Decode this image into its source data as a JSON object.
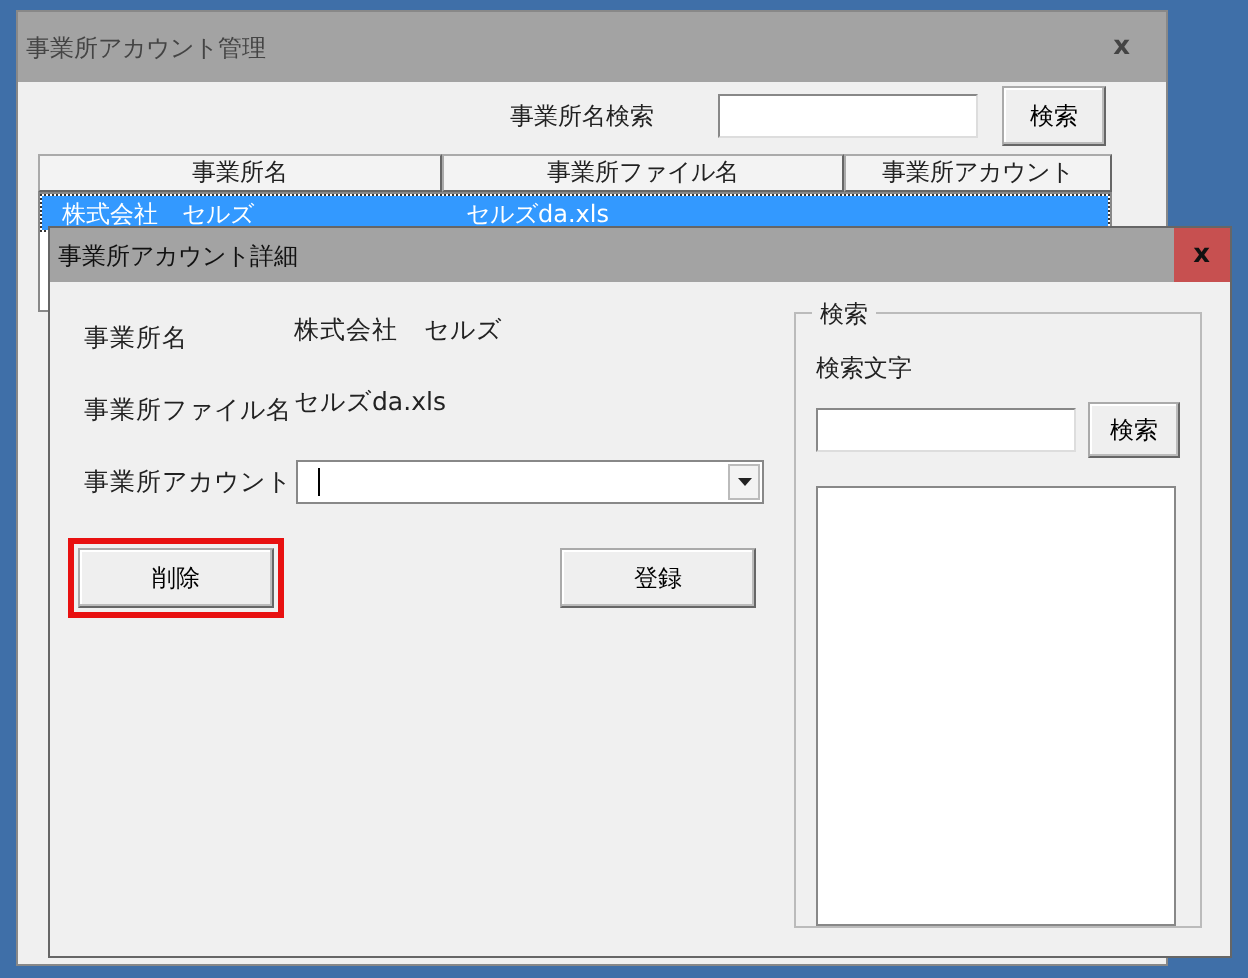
{
  "main_window": {
    "title": "事業所アカウント管理",
    "close": "x",
    "search_label": "事業所名検索",
    "search_button": "検索",
    "list": {
      "columns": [
        "事業所名",
        "事業所ファイル名",
        "事業所アカウント"
      ],
      "rows": [
        {
          "cells": [
            "株式会社　セルズ",
            "セルズda.xls"
          ],
          "selected": true
        }
      ]
    }
  },
  "detail_dialog": {
    "title": "事業所アカウント詳細",
    "close": "x",
    "fields": [
      {
        "kind": "text",
        "label": "事業所名",
        "value": "株式会社　セルズ"
      },
      {
        "kind": "text",
        "label": "事業所ファイル名",
        "value": "セルズda.xls"
      },
      {
        "kind": "combo",
        "label": "事業所アカウント"
      }
    ],
    "buttons": [
      {
        "label": "削除",
        "highlighted": true
      },
      {
        "label": "登録",
        "highlighted": false
      }
    ],
    "search_group": {
      "legend": "検索",
      "label": "検索文字",
      "button": "検索"
    }
  }
}
